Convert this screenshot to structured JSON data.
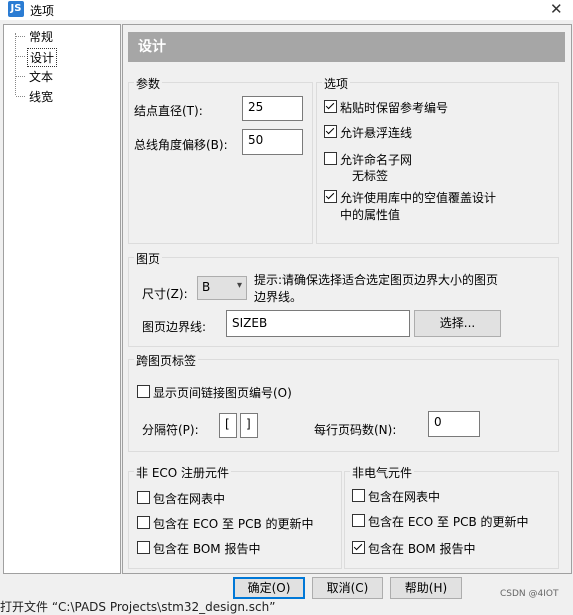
{
  "window": {
    "title": "选项",
    "close": "✕",
    "app_icon": "JS"
  },
  "tree": {
    "items": [
      {
        "label": "常规"
      },
      {
        "label": "设计"
      },
      {
        "label": "文本"
      },
      {
        "label": "线宽"
      }
    ],
    "selected": "设计"
  },
  "header": {
    "title": "设计"
  },
  "params": {
    "title": "参数",
    "node_diameter_label": "结点直径(T):",
    "node_diameter_value": "25",
    "bus_angle_label": "总线角度偏移(B):",
    "bus_angle_value": "50"
  },
  "options": {
    "title": "选项",
    "items": [
      {
        "label": "粘贴时保留参考编号",
        "checked": true
      },
      {
        "label": "允许悬浮连线",
        "checked": true
      },
      {
        "label": "允许命名子网",
        "label2": "无标签",
        "checked": false
      },
      {
        "label": "允许使用库中的空值覆盖设计",
        "label2": "中的属性值",
        "checked": true
      }
    ]
  },
  "page": {
    "title": "图页",
    "size_label": "尺寸(Z):",
    "size_value": "B",
    "hint_line1": "提示:请确保选择适合选定图页边界大小的图页",
    "hint_line2": "边界线。",
    "border_label": "图页边界线:",
    "border_value": "SIZEB",
    "select_button": "选择..."
  },
  "offpage": {
    "title": "跨图页标签",
    "show_link": {
      "label": "显示页间链接图页编号(O)",
      "checked": false
    },
    "separator_label": "分隔符(P):",
    "sep_left": "[",
    "sep_right": "]",
    "per_line_label": "每行页码数(N):",
    "per_line_value": "0"
  },
  "non_eco": {
    "title": "非 ECO 注册元件",
    "items": [
      {
        "label": "包含在网表中",
        "checked": false
      },
      {
        "label": "包含在 ECO 至 PCB 的更新中",
        "checked": false
      },
      {
        "label": "包含在 BOM 报告中",
        "checked": false
      }
    ]
  },
  "non_elec": {
    "title": "非电气元件",
    "items": [
      {
        "label": "包含在网表中",
        "checked": false
      },
      {
        "label": "包含在 ECO 至 PCB 的更新中",
        "checked": false
      },
      {
        "label": "包含在 BOM 报告中",
        "checked": true
      }
    ]
  },
  "buttons": {
    "ok": "确定(O)",
    "cancel": "取消(C)",
    "help": "帮助(H)"
  },
  "status": {
    "text": "打开文件 “C:\\PADS Projects\\stm32_design.sch”"
  },
  "watermark": {
    "text": "CSDN @4IOT"
  }
}
